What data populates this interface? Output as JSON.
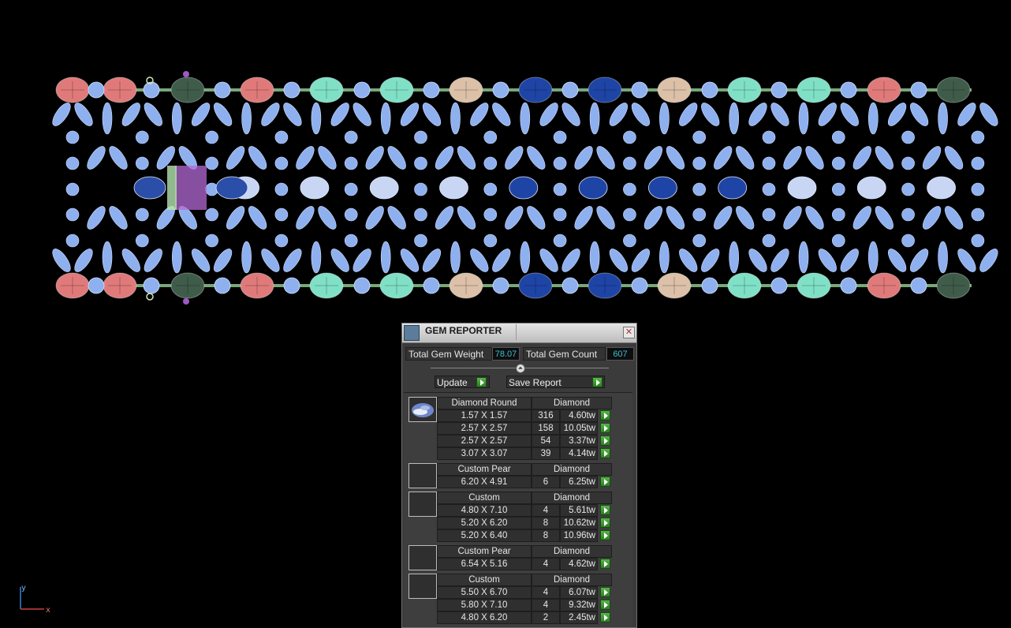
{
  "viewport": {
    "axis": {
      "y_label": "y",
      "x_label": "x"
    },
    "colors": {
      "background": "#000000",
      "diamond": "#8fb0ef",
      "ruby": "#e07a7a",
      "emerald": "#7fe0c6",
      "sapphire": "#1e44a6",
      "morganite": "#dcc0a8",
      "tourmaline": "#3f5c4a",
      "metal": "#9fe0a0"
    }
  },
  "panel": {
    "title": "GEM REPORTER",
    "close_glyph": "✕",
    "total_weight_label": "Total Gem Weight",
    "total_weight_value": "78.07",
    "total_count_label": "Total Gem Count",
    "total_count_value": "607",
    "collapse_glyph": "⏶",
    "update_label": "Update",
    "save_report_label": "Save Report",
    "groups": [
      {
        "shape": "Diamond Round",
        "material": "Diamond",
        "rows": [
          {
            "size": "1.57 X 1.57",
            "count": "316",
            "weight": "4.60tw"
          },
          {
            "size": "2.57 X 2.57",
            "count": "158",
            "weight": "10.05tw"
          },
          {
            "size": "2.57 X 2.57",
            "count": "54",
            "weight": "3.37tw"
          },
          {
            "size": "3.07 X 3.07",
            "count": "39",
            "weight": "4.14tw"
          }
        ]
      },
      {
        "shape": "Custom Pear",
        "material": "Diamond",
        "rows": [
          {
            "size": "6.20 X 4.91",
            "count": "6",
            "weight": "6.25tw"
          }
        ]
      },
      {
        "shape": "Custom",
        "material": "Diamond",
        "rows": [
          {
            "size": "4.80 X 7.10",
            "count": "4",
            "weight": "5.61tw"
          },
          {
            "size": "5.20 X 6.20",
            "count": "8",
            "weight": "10.62tw"
          },
          {
            "size": "5.20 X 6.40",
            "count": "8",
            "weight": "10.96tw"
          }
        ]
      },
      {
        "shape": "Custom Pear",
        "material": "Diamond",
        "rows": [
          {
            "size": "6.54 X 5.16",
            "count": "4",
            "weight": "4.62tw"
          }
        ]
      },
      {
        "shape": "Custom",
        "material": "Diamond",
        "rows": [
          {
            "size": "5.50 X 6.70",
            "count": "4",
            "weight": "6.07tw"
          },
          {
            "size": "5.80 X 7.10",
            "count": "4",
            "weight": "9.32tw"
          },
          {
            "size": "4.80 X 6.20",
            "count": "2",
            "weight": "2.45tw"
          }
        ]
      }
    ]
  }
}
